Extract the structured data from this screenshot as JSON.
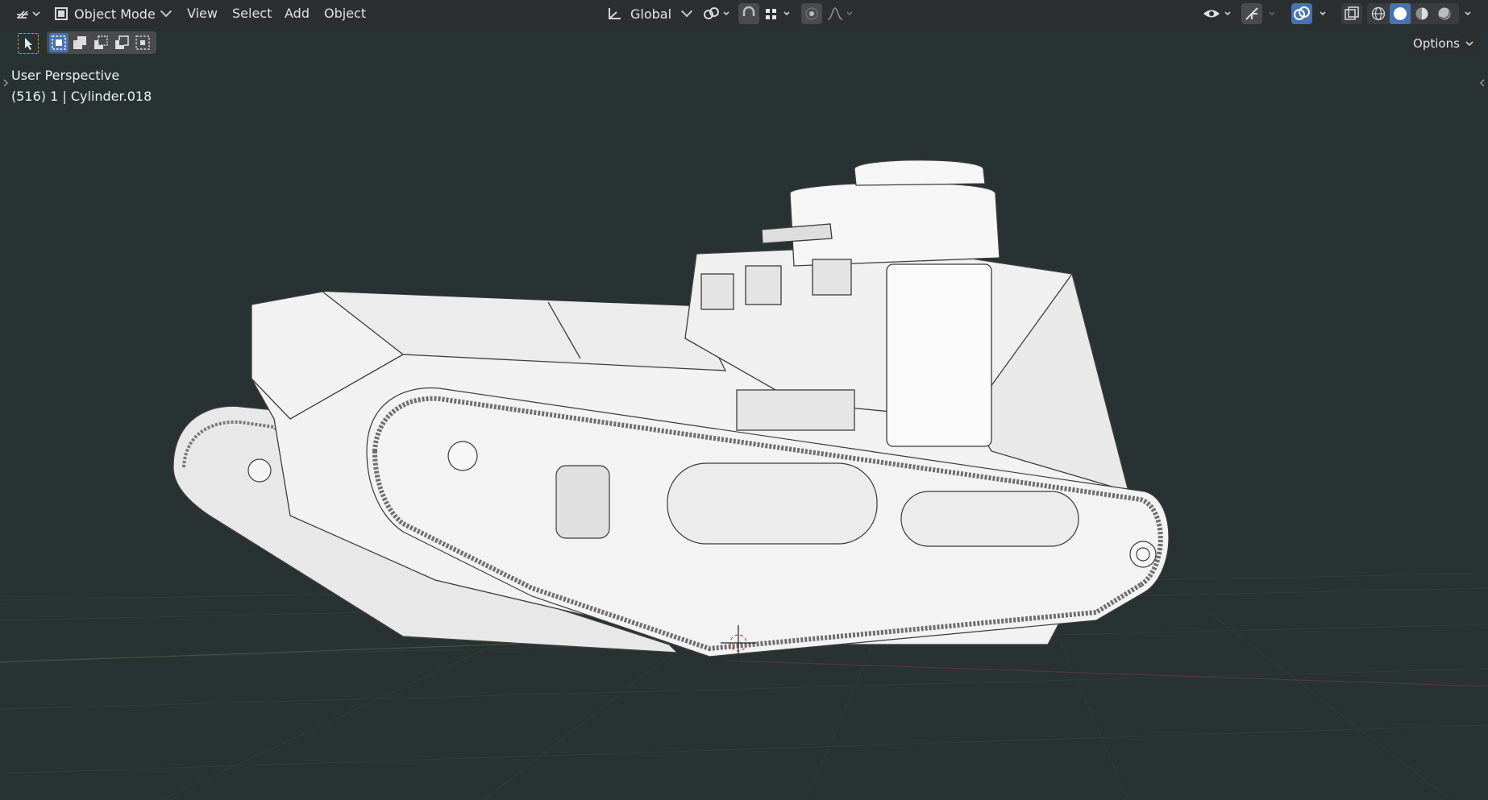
{
  "header": {
    "editor_type_icon": "editor-type-icon",
    "mode": {
      "label": "Object Mode",
      "icon": "object-mode-icon"
    },
    "menus": [
      "View",
      "Select",
      "Add",
      "Object"
    ],
    "transform_orientation": {
      "label": "Global",
      "icon": "orientation-axes-icon"
    },
    "pivot_icon": "pivot-link-icon",
    "snap_icon": "snap-magnet-icon",
    "snap_target_icon": "snap-grid-icon",
    "proportional_icon": "proportional-edit-icon",
    "falloff_icon": "falloff-curve-icon",
    "right_icons": [
      "visibility-eye-icon",
      "gizmo-icon",
      "overlay-icon",
      "xray-icon",
      "wireframe-shading-icon",
      "solid-shading-icon",
      "material-shading-icon",
      "rendered-shading-icon"
    ]
  },
  "toolbar": {
    "options_label": "Options",
    "select_tool_icon": "select-cursor-icon",
    "selection_modes": [
      "select-new-icon",
      "select-extend-icon",
      "select-subtract-icon",
      "select-invert-icon",
      "select-intersect-icon"
    ]
  },
  "viewport": {
    "view_name": "User Perspective",
    "object_info": "(516) 1 | Cylinder.018",
    "background_color": "#283232",
    "model": "tank-wireframe-model"
  },
  "colors": {
    "header_bg": "#2c2f30",
    "accent_blue": "#4772b3",
    "grid_line": "#3a4242"
  }
}
